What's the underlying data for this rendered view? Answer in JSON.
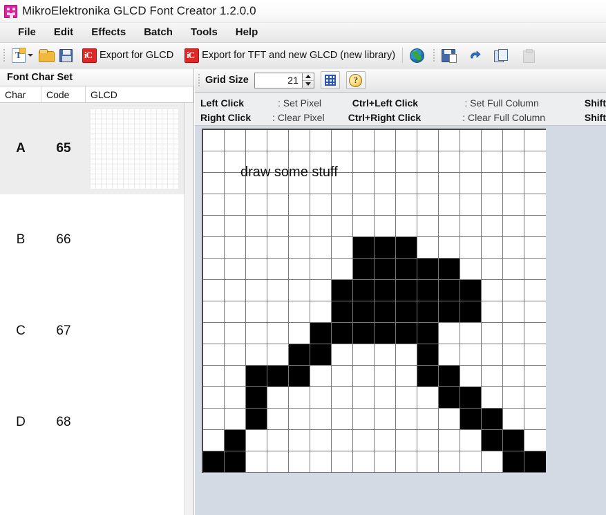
{
  "window": {
    "title": "MikroElektronika GLCD Font Creator 1.2.0.0",
    "icon": "app-icon"
  },
  "menubar": {
    "items": [
      {
        "label": "File"
      },
      {
        "label": "Edit"
      },
      {
        "label": "Effects"
      },
      {
        "label": "Batch"
      },
      {
        "label": "Tools"
      },
      {
        "label": "Help"
      }
    ]
  },
  "toolbar": {
    "buttons": [
      {
        "icon": "new-font-icon",
        "label": ""
      },
      {
        "icon": "open-folder-icon",
        "label": ""
      },
      {
        "icon": "save-icon",
        "label": ""
      },
      {
        "icon": "export-glcd-icon",
        "label": "Export for GLCD"
      },
      {
        "icon": "export-tft-icon",
        "label": "Export for TFT and new GLCD (new library)"
      },
      {
        "icon": "globe-icon",
        "label": ""
      },
      {
        "icon": "save-as-icon",
        "label": ""
      },
      {
        "icon": "undo-icon",
        "label": ""
      },
      {
        "icon": "copy-icon",
        "label": ""
      },
      {
        "icon": "paste-icon",
        "label": ""
      }
    ],
    "export_glcd_label": "Export for GLCD",
    "export_tft_label": "Export for TFT and new GLCD (new library)"
  },
  "charset_panel": {
    "title": "Font Char Set",
    "columns": [
      "Char",
      "Code",
      "GLCD"
    ],
    "rows": [
      {
        "char": "A",
        "code": "65",
        "selected": true,
        "has_preview": true
      },
      {
        "char": "B",
        "code": "66",
        "selected": false,
        "has_preview": false
      },
      {
        "char": "C",
        "code": "67",
        "selected": false,
        "has_preview": false
      },
      {
        "char": "D",
        "code": "68",
        "selected": false,
        "has_preview": false
      }
    ]
  },
  "grid_toolbar": {
    "grid_size_label": "Grid Size",
    "grid_size_value": "21",
    "grid_toggle_icon": "grid-icon",
    "help_icon": "help-icon"
  },
  "legend": {
    "rows": [
      {
        "c1_key": "Left Click",
        "c1_val": ": Set Pixel",
        "c2_key": "Ctrl+Left Click",
        "c2_val": ": Set Full Column",
        "c3_key": "Shift"
      },
      {
        "c1_key": "Right Click",
        "c1_val": ": Clear Pixel",
        "c2_key": "Ctrl+Right Click",
        "c2_val": ": Clear Full Column",
        "c3_key": "Shift"
      }
    ]
  },
  "canvas": {
    "annotation": "draw some stuff",
    "cols": 16,
    "rows": 16,
    "on_color": "#000000",
    "off_color": "#ffffff",
    "grid_line_color": "#777777",
    "pixels": [
      [
        0,
        0,
        0,
        0,
        0,
        0,
        0,
        0,
        0,
        0,
        0,
        0,
        0,
        0,
        0,
        0
      ],
      [
        0,
        0,
        0,
        0,
        0,
        0,
        0,
        0,
        0,
        0,
        0,
        0,
        0,
        0,
        0,
        0
      ],
      [
        0,
        0,
        0,
        0,
        0,
        0,
        0,
        0,
        0,
        0,
        0,
        0,
        0,
        0,
        0,
        0
      ],
      [
        0,
        0,
        0,
        0,
        0,
        0,
        0,
        0,
        0,
        0,
        0,
        0,
        0,
        0,
        0,
        0
      ],
      [
        0,
        0,
        0,
        0,
        0,
        0,
        0,
        0,
        0,
        0,
        0,
        0,
        0,
        0,
        0,
        0
      ],
      [
        0,
        0,
        0,
        0,
        0,
        0,
        0,
        1,
        1,
        1,
        0,
        0,
        0,
        0,
        0,
        0
      ],
      [
        0,
        0,
        0,
        0,
        0,
        0,
        0,
        1,
        1,
        1,
        1,
        1,
        0,
        0,
        0,
        0
      ],
      [
        0,
        0,
        0,
        0,
        0,
        0,
        1,
        1,
        1,
        1,
        1,
        1,
        1,
        0,
        0,
        0
      ],
      [
        0,
        0,
        0,
        0,
        0,
        0,
        1,
        1,
        1,
        1,
        1,
        1,
        1,
        0,
        0,
        0
      ],
      [
        0,
        0,
        0,
        0,
        0,
        1,
        1,
        1,
        1,
        1,
        1,
        0,
        0,
        0,
        0,
        0
      ],
      [
        0,
        0,
        0,
        0,
        1,
        1,
        0,
        0,
        0,
        0,
        1,
        0,
        0,
        0,
        0,
        0
      ],
      [
        0,
        0,
        1,
        1,
        1,
        0,
        0,
        0,
        0,
        0,
        1,
        1,
        0,
        0,
        0,
        0
      ],
      [
        0,
        0,
        1,
        0,
        0,
        0,
        0,
        0,
        0,
        0,
        0,
        1,
        1,
        0,
        0,
        0
      ],
      [
        0,
        0,
        1,
        0,
        0,
        0,
        0,
        0,
        0,
        0,
        0,
        0,
        1,
        1,
        0,
        0
      ],
      [
        0,
        1,
        0,
        0,
        0,
        0,
        0,
        0,
        0,
        0,
        0,
        0,
        0,
        1,
        1,
        0
      ],
      [
        1,
        1,
        0,
        0,
        0,
        0,
        0,
        0,
        0,
        0,
        0,
        0,
        0,
        0,
        1,
        1
      ]
    ]
  },
  "colors": {
    "accent_magenta": "#e0219c",
    "accent_red": "#e02727",
    "accent_blue": "#2a55b5",
    "panel_bg": "#d3dae3",
    "selected_row_bg": "#ededed"
  }
}
